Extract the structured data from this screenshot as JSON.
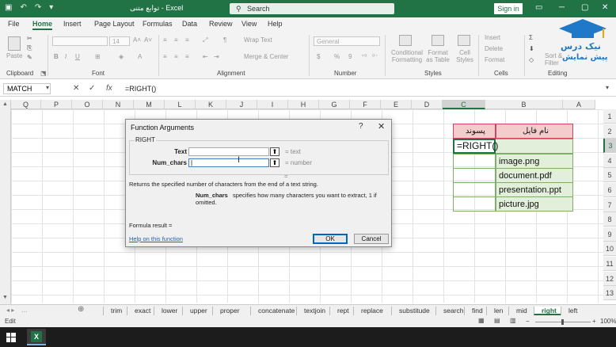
{
  "window": {
    "title": "توابع متنی - Excel",
    "search_placeholder": "Search",
    "signin_label": "Sign in"
  },
  "ribbon_tabs": [
    "File",
    "Home",
    "Insert",
    "Page Layout",
    "Formulas",
    "Data",
    "Review",
    "View",
    "Help"
  ],
  "ribbon": {
    "clipboard": {
      "label": "Clipboard",
      "paste": "Paste"
    },
    "font": {
      "label": "Font",
      "font_name": "",
      "font_size": "14",
      "bold": "B",
      "italic": "I",
      "underline": "U"
    },
    "alignment": {
      "label": "Alignment",
      "wrap_text": "Wrap Text",
      "merge_center": "Merge & Center"
    },
    "number": {
      "label": "Number",
      "format": "General",
      "currency": "$",
      "percent": "%",
      "comma": "9"
    },
    "styles": {
      "label": "Styles",
      "conditional": "Conditional Formatting",
      "format_table": "Format as Table",
      "cell_styles": "Cell Styles"
    },
    "cells": {
      "label": "Cells",
      "insert": "Insert",
      "delete": "Delete",
      "format": "Format"
    },
    "editing": {
      "label": "Editing",
      "sort_filter": "Sort & Filter"
    }
  },
  "formula_bar": {
    "name_box": "MATCH",
    "cancel": "✕",
    "enter": "✓",
    "fx": "fx",
    "content": "=RIGHT()"
  },
  "columns": [
    "Q",
    "P",
    "O",
    "N",
    "M",
    "L",
    "K",
    "J",
    "I",
    "H",
    "G",
    "F",
    "E",
    "D",
    "C",
    "B",
    "A"
  ],
  "rows": [
    "1",
    "2",
    "3",
    "4",
    "5",
    "6",
    "7",
    "8",
    "9",
    "10",
    "11",
    "12",
    "13"
  ],
  "cells": {
    "header_c": "پسوند",
    "header_b": "نام فایل",
    "c3": "=RIGHT()",
    "b4": "image.png",
    "b5": "document.pdf",
    "b6": "presentation.ppt",
    "b7": "picture.jpg"
  },
  "dialog": {
    "title": "Function Arguments",
    "help_mark": "?",
    "close_mark": "✕",
    "function_name": "RIGHT",
    "args": [
      {
        "label": "Text",
        "value": "",
        "result": "= text"
      },
      {
        "label": "Num_chars",
        "value": "|",
        "result": "= number"
      }
    ],
    "eq_line": "=",
    "description": "Returns the specified number of characters from the end of a text string.",
    "arg_desc_name": "Num_chars",
    "arg_desc_text": "specifies how many characters you want to extract, 1 if omitted.",
    "formula_result": "Formula result =",
    "help_link": "Help on this function",
    "ok": "OK",
    "cancel": "Cancel"
  },
  "sheet_tabs": [
    "trim",
    "exact",
    "lower",
    "upper",
    "proper",
    "concatenate",
    "textjoin",
    "rept",
    "replace",
    "substitude",
    "search",
    "find",
    "len",
    "mid",
    "right",
    "left"
  ],
  "active_sheet": "right",
  "status": {
    "mode": "Edit",
    "zoom": "100%"
  },
  "watermark": {
    "line1": "نیک درس",
    "line2": "پیش نمایش"
  }
}
